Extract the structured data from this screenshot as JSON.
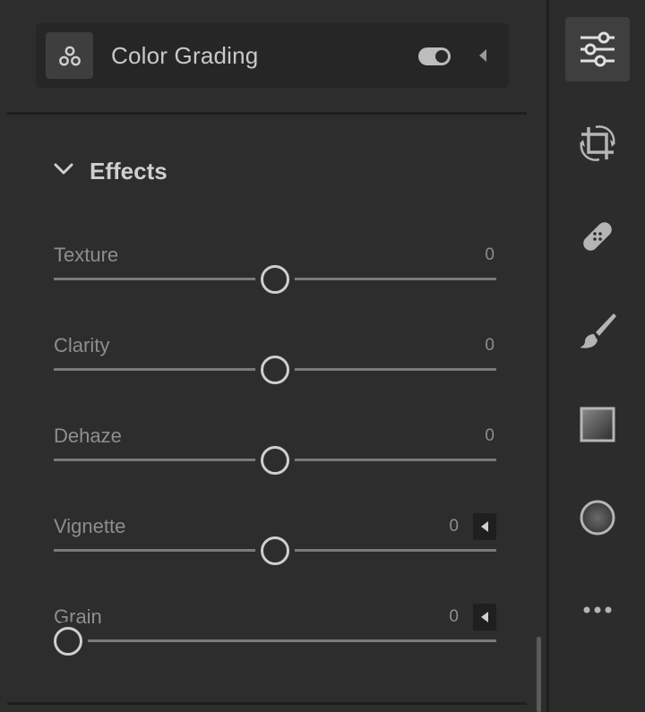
{
  "color_grading": {
    "title": "Color Grading",
    "enabled": true
  },
  "effects": {
    "title": "Effects",
    "expanded": true,
    "sliders": [
      {
        "label": "Texture",
        "value": "0",
        "min": -100,
        "max": 100,
        "has_menu": false
      },
      {
        "label": "Clarity",
        "value": "0",
        "min": -100,
        "max": 100,
        "has_menu": false
      },
      {
        "label": "Dehaze",
        "value": "0",
        "min": -100,
        "max": 100,
        "has_menu": false
      },
      {
        "label": "Vignette",
        "value": "0",
        "min": -100,
        "max": 100,
        "has_menu": true
      },
      {
        "label": "Grain",
        "value": "0",
        "min": 0,
        "max": 100,
        "has_menu": true
      }
    ]
  },
  "toolbar": {
    "tools": [
      {
        "name": "edit-sliders-icon",
        "active": true
      },
      {
        "name": "crop-rotate-icon",
        "active": false
      },
      {
        "name": "healing-bandage-icon",
        "active": false
      },
      {
        "name": "brush-icon",
        "active": false
      },
      {
        "name": "linear-gradient-icon",
        "active": false
      },
      {
        "name": "radial-gradient-icon",
        "active": false
      },
      {
        "name": "more-icon",
        "active": false
      }
    ]
  },
  "colors": {
    "panel_bg": "#2d2d2d",
    "header_bg": "#262626",
    "text": "#c9c9c9",
    "muted_text": "#8e8e8e",
    "track": "#7a7a7a"
  }
}
